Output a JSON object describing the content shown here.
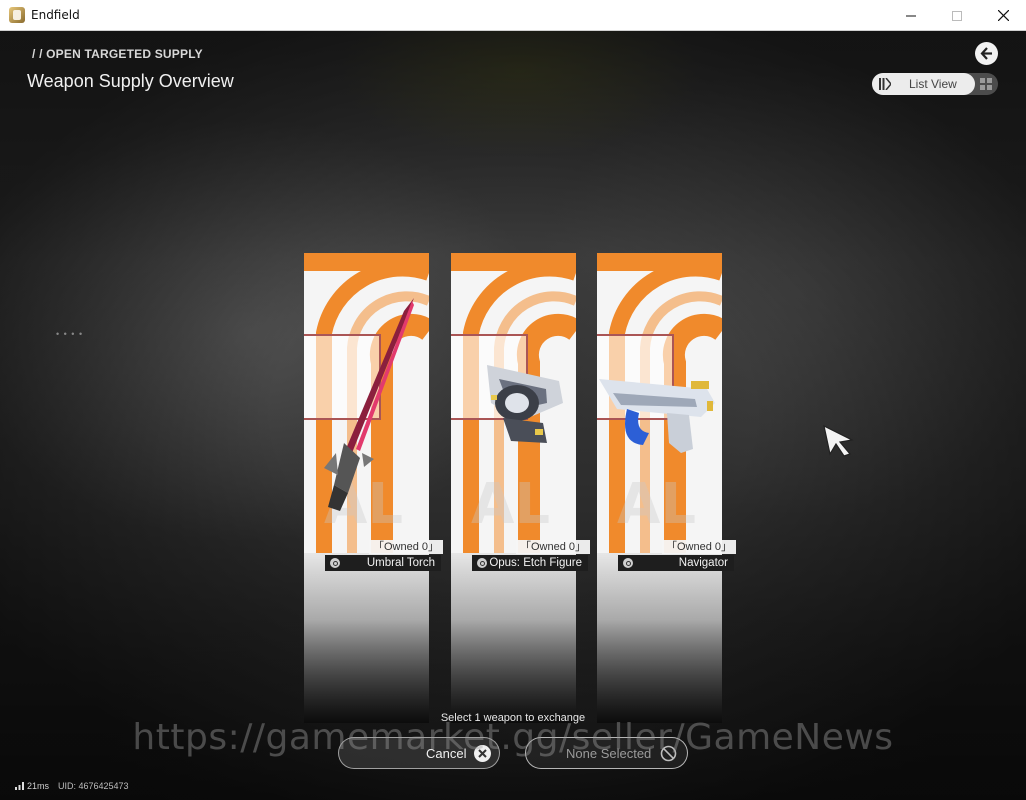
{
  "window": {
    "title": "Endfield"
  },
  "header": {
    "breadcrumb": "/ / OPEN TARGETED SUPPLY",
    "title": "Weapon Supply Overview",
    "view_toggle_label": "List View"
  },
  "weapons": [
    {
      "owned": "「Owned  0」",
      "name": "Umbral Torch"
    },
    {
      "owned": "「Owned  0」",
      "name": "Opus: Etch Figure"
    },
    {
      "owned": "「Owned  0」",
      "name": "Navigator"
    }
  ],
  "footer": {
    "prompt": "Select 1 weapon to exchange",
    "cancel_label": "Cancel",
    "selection_label": "None Selected",
    "watermark": "https://gamemarket.gg/seller/GameNews"
  },
  "status": {
    "latency": "21ms",
    "uid": "UID: 4676425473"
  },
  "colors": {
    "accent_orange": "#f08a2c",
    "card_bg": "#f2f2f2",
    "name_bar": "#1e1e1e"
  },
  "icons": [
    "back-arrow-icon",
    "list-view-icon",
    "grid-view-icon",
    "zoom-icon",
    "close-icon",
    "ban-icon",
    "signal-icon",
    "cursor-icon"
  ]
}
